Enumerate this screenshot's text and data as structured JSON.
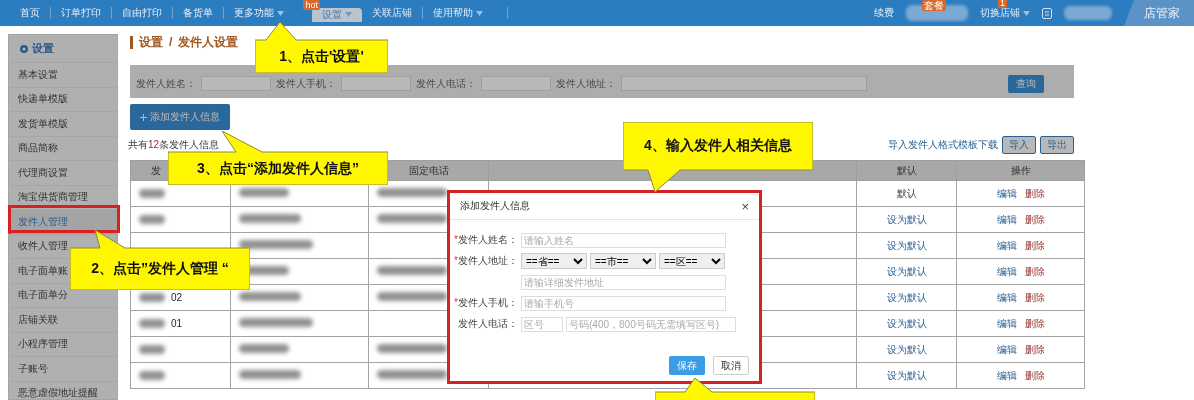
{
  "nav": {
    "items": [
      {
        "label": "首页",
        "selected": false,
        "menu": false
      },
      {
        "label": "订单打印",
        "selected": false,
        "menu": false
      },
      {
        "label": "自由打印",
        "selected": false,
        "menu": false
      },
      {
        "label": "备货单",
        "selected": false,
        "menu": false
      },
      {
        "label": "更多功能",
        "selected": false,
        "menu": true,
        "badge": "hot"
      },
      {
        "label": "设置",
        "selected": true,
        "menu": true
      },
      {
        "label": "关联店铺",
        "selected": false,
        "menu": false
      },
      {
        "label": "使用帮助",
        "selected": false,
        "menu": true
      }
    ],
    "right": {
      "renew": "续费",
      "plan_badge": "套餐",
      "switch_store": "切换店铺",
      "switch_badge": "1",
      "logo": "店管家"
    }
  },
  "sidebar": {
    "title": "设置",
    "items": [
      {
        "label": "基本设置",
        "selected": false
      },
      {
        "label": "快递单模版",
        "selected": false
      },
      {
        "label": "发货单模版",
        "selected": false
      },
      {
        "label": "商品简称",
        "selected": false
      },
      {
        "label": "代理商设置",
        "selected": false
      },
      {
        "label": "淘宝供货商管理",
        "selected": false
      },
      {
        "label": "发件人管理",
        "selected": true
      },
      {
        "label": "收件人管理",
        "selected": false
      },
      {
        "label": "电子面单账",
        "selected": false
      },
      {
        "label": "电子面单分",
        "selected": false
      },
      {
        "label": "店铺关联",
        "selected": false
      },
      {
        "label": "小程序管理",
        "selected": false
      },
      {
        "label": "子账号",
        "selected": false
      },
      {
        "label": "恶意虚假地址提醒",
        "selected": false
      }
    ]
  },
  "breadcrumb": {
    "items": [
      "设置",
      "发件人设置"
    ],
    "separator": "/"
  },
  "search": {
    "fields": [
      "发件人姓名：",
      "发件人手机：",
      "发件人电话：",
      "发件人地址："
    ],
    "button": "查询"
  },
  "add_button": "添加发件人信息",
  "summary": {
    "prefix": "共有",
    "count": "12",
    "suffix": "条发件人信息"
  },
  "import": {
    "link": "导入发件人格式模板下载",
    "buttons": [
      "导入",
      "导出"
    ]
  },
  "table": {
    "headers": {
      "column_1": "发",
      "column_3": "固定电话",
      "column_5": "默认",
      "column_6": "操作"
    },
    "rows": [
      {
        "is_default": true,
        "default_text": "默认",
        "actions": [
          "编辑",
          "删除"
        ]
      },
      {
        "is_default": false,
        "default_text": "设为默认",
        "actions": [
          "编辑",
          "删除"
        ]
      },
      {
        "is_default": false,
        "default_text": "设为默认",
        "actions": [
          "编辑",
          "删除"
        ]
      },
      {
        "is_default": false,
        "default_text": "设为默认",
        "actions": [
          "编辑",
          "删除"
        ]
      },
      {
        "is_default": false,
        "default_text": "设为默认",
        "actions": [
          "编辑",
          "删除"
        ],
        "code": "02"
      },
      {
        "is_default": false,
        "default_text": "设为默认",
        "actions": [
          "编辑",
          "删除"
        ],
        "code": "01"
      },
      {
        "is_default": false,
        "default_text": "设为默认",
        "actions": [
          "编辑",
          "删除"
        ]
      },
      {
        "is_default": false,
        "default_text": "设为默认",
        "actions": [
          "编辑",
          "删除"
        ]
      }
    ]
  },
  "modal": {
    "title": "添加发件人信息",
    "close": "×",
    "fields": [
      {
        "kind": "text",
        "marker": "*",
        "label": "发件人姓名：",
        "placeholder": "请输入姓名"
      },
      {
        "kind": "selects",
        "marker": "*",
        "label": "发件人地址：",
        "values": [
          "==省==",
          "==市==",
          "==区=="
        ]
      },
      {
        "kind": "text",
        "placeholder": "请输详细发件地址"
      },
      {
        "kind": "text",
        "marker": "*",
        "label": "发件人手机：",
        "placeholder": "请输手机号"
      },
      {
        "kind": "phone",
        "label": "发件人电话：",
        "placeholders": [
          "区号",
          "号码(400，800号码无需填写区号)"
        ]
      }
    ],
    "buttons": [
      {
        "label": "保存",
        "kind": "primary"
      },
      {
        "label": "取消",
        "kind": "default"
      }
    ]
  },
  "callouts": [
    {
      "text": "1、点击'设置'"
    },
    {
      "text": "2、点击”发件人管理 “"
    },
    {
      "text": "3、点击“添加发件人信息”"
    },
    {
      "text": "4、输入发件人相关信息"
    }
  ]
}
